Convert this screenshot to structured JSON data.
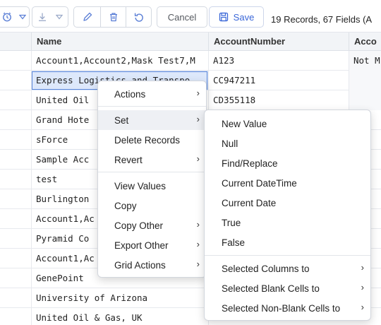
{
  "toolbar": {
    "icons": [
      "clock-settings-icon",
      "chevron-down-icon",
      "download-icon",
      "chevron-down-icon",
      "pencil-icon",
      "trash-icon",
      "undo-icon"
    ],
    "cancel_label": "Cancel",
    "save_label": "Save",
    "records_text": "19 Records, 67 Fields (A"
  },
  "grid": {
    "columns": [
      "Name",
      "AccountNumber",
      "Acco"
    ],
    "rows": [
      {
        "name": "Account1,Account2,Mask Test7,M",
        "acct": "A123",
        "acc3": "Not M"
      },
      {
        "name": "Express Logistics and Transpo",
        "acct": "CC947211",
        "acc3": ""
      },
      {
        "name": "United Oil",
        "acct": "CD355118",
        "acc3": ""
      },
      {
        "name": "Grand Hote",
        "acct": "",
        "acc3": ""
      },
      {
        "name": "sForce",
        "acct": "",
        "acc3": ""
      },
      {
        "name": "Sample Acc",
        "acct": "",
        "acc3": ""
      },
      {
        "name": "test",
        "acct": "",
        "acc3": ""
      },
      {
        "name": "Burlington",
        "acct": "",
        "acc3": ""
      },
      {
        "name": "Account1,Ac",
        "acct": "",
        "acc3": ""
      },
      {
        "name": "Pyramid Co",
        "acct": "",
        "acc3": ""
      },
      {
        "name": "Account1,Ac",
        "acct": "",
        "acc3": ""
      },
      {
        "name": "GenePoint",
        "acct": "",
        "acc3": ""
      },
      {
        "name": "University of Arizona",
        "acct": "",
        "acc3": ""
      },
      {
        "name": "United Oil & Gas, UK",
        "acct": "",
        "acc3": ""
      }
    ]
  },
  "context_menu": {
    "items": [
      {
        "label": "Actions",
        "submenu": true
      },
      {
        "label": "Set",
        "submenu": true
      },
      {
        "label": "Delete Records",
        "submenu": false
      },
      {
        "label": "Revert",
        "submenu": true
      },
      {
        "label": "View Values",
        "submenu": false
      },
      {
        "label": "Copy",
        "submenu": false
      },
      {
        "label": "Copy Other",
        "submenu": true
      },
      {
        "label": "Export Other",
        "submenu": true
      },
      {
        "label": "Grid Actions",
        "submenu": true
      }
    ]
  },
  "set_submenu": {
    "items": [
      {
        "label": "New Value",
        "submenu": false
      },
      {
        "label": "Null",
        "submenu": false
      },
      {
        "label": "Find/Replace",
        "submenu": false
      },
      {
        "label": "Current DateTime",
        "submenu": false
      },
      {
        "label": "Current Date",
        "submenu": false
      },
      {
        "label": "True",
        "submenu": false
      },
      {
        "label": "False",
        "submenu": false
      },
      {
        "label": "Selected Columns to",
        "submenu": true
      },
      {
        "label": "Selected Blank Cells to",
        "submenu": true
      },
      {
        "label": "Selected Non-Blank Cells to",
        "submenu": true
      }
    ]
  },
  "chevron_glyph": "›",
  "colors": {
    "accent": "#3a67d8",
    "selection": "#dde8fb",
    "selection_border": "#5a86d8",
    "hover": "#eef0f4"
  }
}
